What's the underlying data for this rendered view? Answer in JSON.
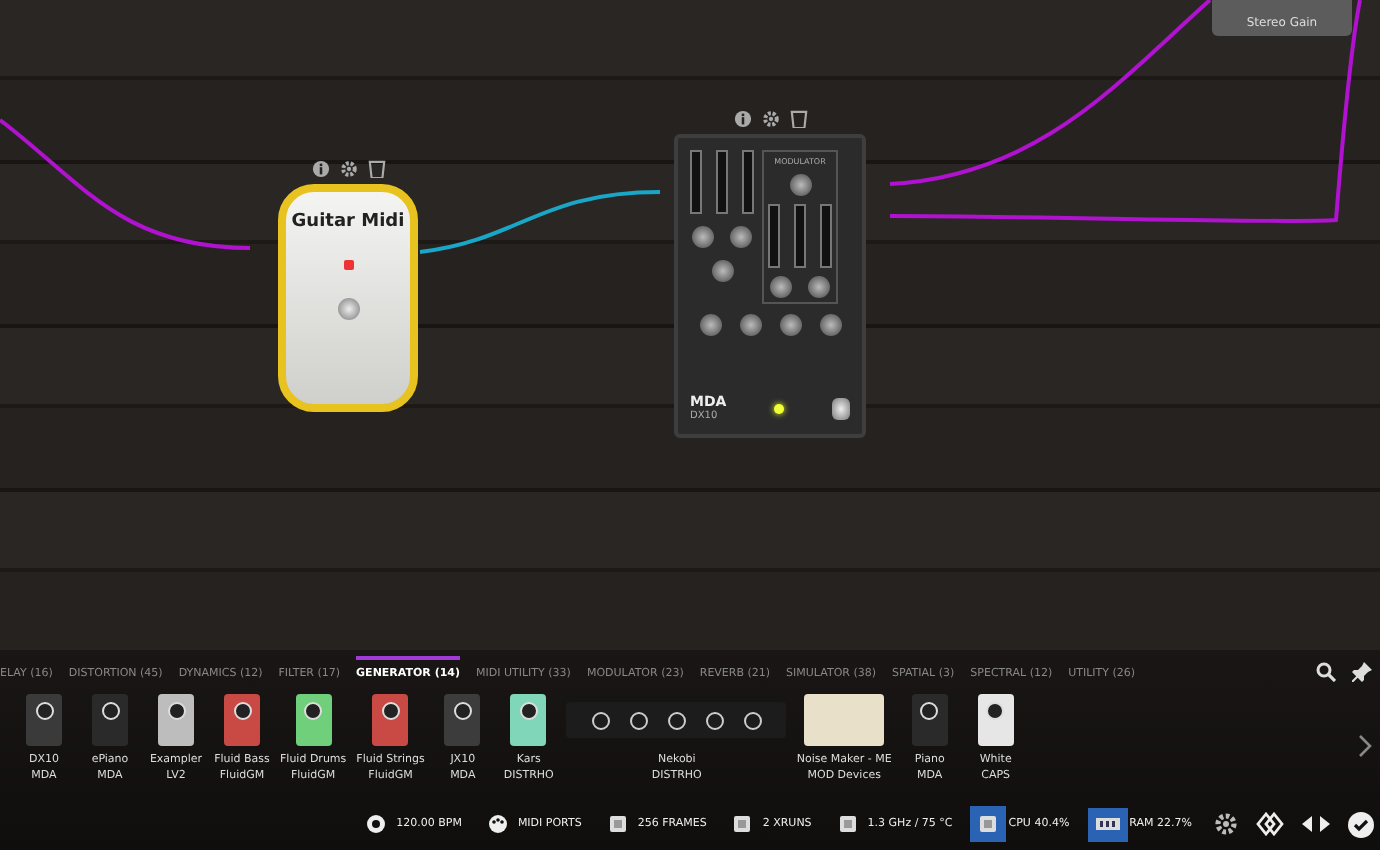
{
  "board": {
    "pedals": [
      {
        "kind": "tin",
        "title": "Guitar Midi"
      },
      {
        "kind": "synth",
        "brand": "MDA",
        "model": "DX10",
        "section": "MODULATOR"
      },
      {
        "kind": "box",
        "title": "Stereo Gain"
      }
    ]
  },
  "tabs": [
    {
      "label": "ELAY (16)",
      "selected": false
    },
    {
      "label": "DISTORTION (45)",
      "selected": false
    },
    {
      "label": "DYNAMICS (12)",
      "selected": false
    },
    {
      "label": "FILTER (17)",
      "selected": false
    },
    {
      "label": "GENERATOR (14)",
      "selected": true
    },
    {
      "label": "MIDI UTILITY (33)",
      "selected": false
    },
    {
      "label": "MODULATOR (23)",
      "selected": false
    },
    {
      "label": "REVERB (21)",
      "selected": false
    },
    {
      "label": "SIMULATOR (38)",
      "selected": false
    },
    {
      "label": "SPATIAL (3)",
      "selected": false
    },
    {
      "label": "SPECTRAL (12)",
      "selected": false
    },
    {
      "label": "UTILITY (26)",
      "selected": false
    }
  ],
  "plugins": [
    {
      "name": "DX10",
      "maker": "MDA",
      "kind": "pedal",
      "color": "#3a3a3a"
    },
    {
      "name": "ePiano",
      "maker": "MDA",
      "kind": "pedal",
      "color": "#2a2a2a"
    },
    {
      "name": "Exampler",
      "maker": "LV2",
      "kind": "pedal",
      "color": "#bdbdbd"
    },
    {
      "name": "Fluid Bass",
      "maker": "FluidGM",
      "kind": "pedal",
      "color": "#c94a44"
    },
    {
      "name": "Fluid Drums",
      "maker": "FluidGM",
      "kind": "pedal",
      "color": "#6fcf7a"
    },
    {
      "name": "Fluid Strings",
      "maker": "FluidGM",
      "kind": "pedal",
      "color": "#c94a44"
    },
    {
      "name": "JX10",
      "maker": "MDA",
      "kind": "pedal",
      "color": "#3c3c3c"
    },
    {
      "name": "Kars",
      "maker": "DISTRHO",
      "kind": "pedal",
      "color": "#7fd6b9"
    },
    {
      "name": "Nekobi",
      "maker": "DISTRHO",
      "kind": "rack",
      "color": "#1c1c1c"
    },
    {
      "name": "Noise Maker - ME",
      "maker": "MOD Devices",
      "kind": "panel",
      "color": "#e8e0c8"
    },
    {
      "name": "Piano",
      "maker": "MDA",
      "kind": "pedal",
      "color": "#2a2a2a"
    },
    {
      "name": "White",
      "maker": "CAPS",
      "kind": "pedal",
      "color": "#e6e6e6"
    }
  ],
  "status_bar": [
    {
      "kind": "bpm",
      "text": "120.00 BPM",
      "active": false
    },
    {
      "kind": "midi",
      "text": "MIDI PORTS",
      "active": false
    },
    {
      "kind": "chip",
      "text": "256 FRAMES",
      "active": false
    },
    {
      "kind": "chip",
      "text": "2 XRUNS",
      "active": false
    },
    {
      "kind": "chip",
      "text": "1.3 GHz / 75 °C",
      "active": false
    },
    {
      "kind": "chip",
      "text": "CPU 40.4%",
      "active": true
    },
    {
      "kind": "ram",
      "text": "RAM 22.7%",
      "active": true
    }
  ]
}
